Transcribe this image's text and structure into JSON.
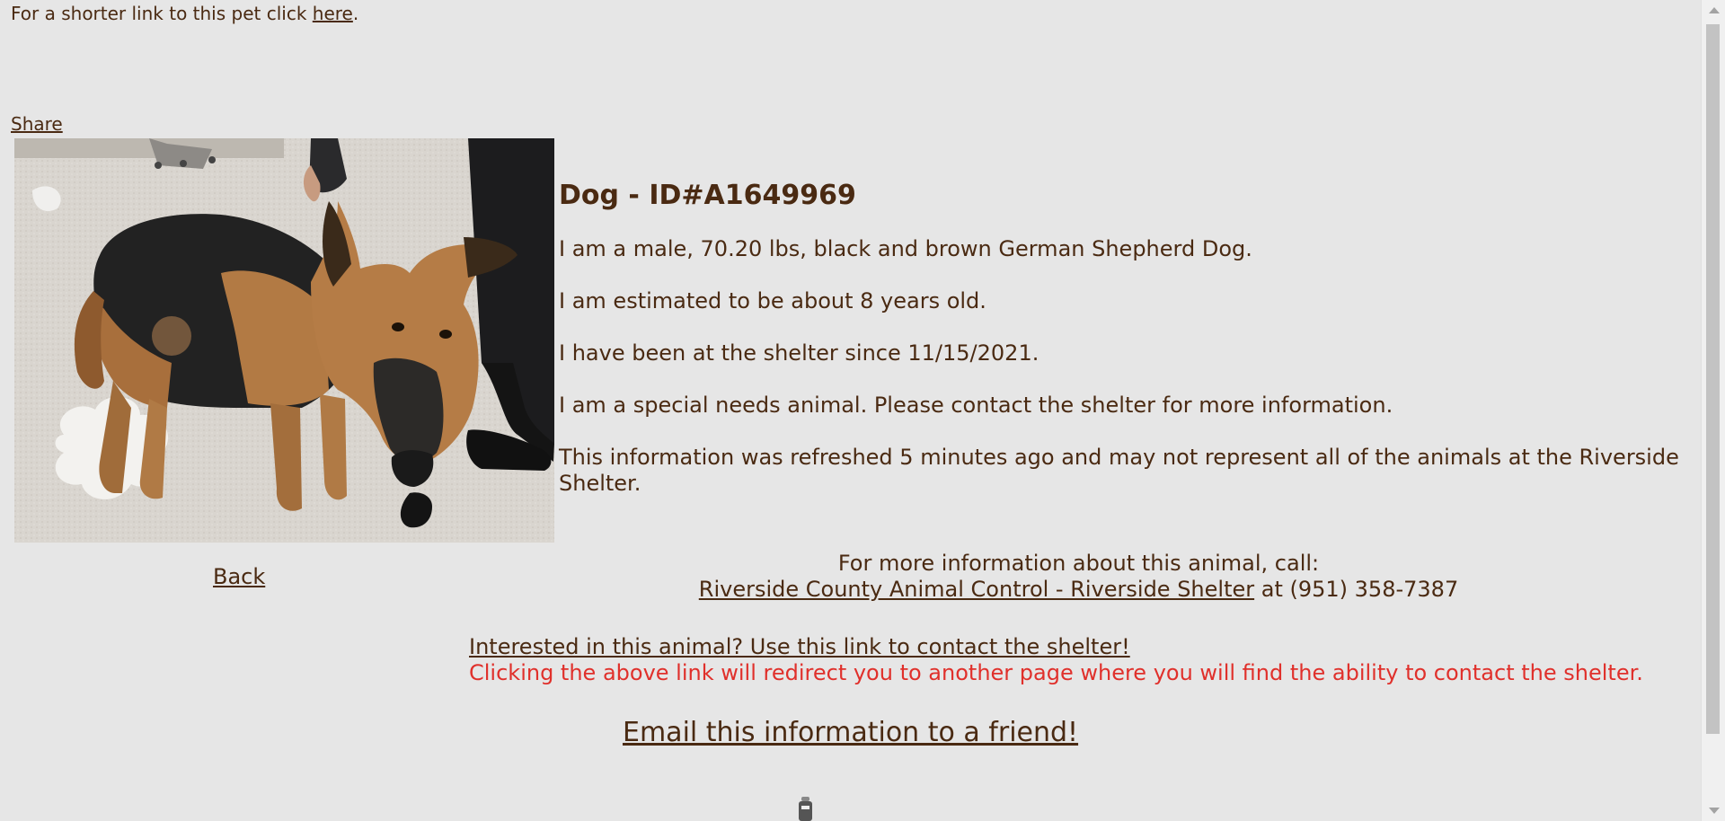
{
  "top_line": {
    "prefix": "For a shorter link to this pet click ",
    "link": "here",
    "suffix": "."
  },
  "share_label": "Share",
  "back_label": "Back",
  "animal": {
    "heading": "Dog - ID#A1649969",
    "description": "I am a male, 70.20 lbs, black and brown German Shepherd Dog.",
    "age": "I am estimated to be about 8 years old.",
    "since": "I have been at the shelter since 11/15/2021.",
    "special": "I am a special needs animal. Please contact the shelter for more information.",
    "refresh": "This information was refreshed 5 minutes ago and may not represent all of the animals at the Riverside Shelter."
  },
  "contact": {
    "intro": "For more information about this animal, call:",
    "shelter_link": "Riverside County Animal Control - Riverside Shelter",
    "phone_text": " at (951) 358-7387"
  },
  "interest": {
    "link": "Interested in this animal? Use this link to contact the shelter!",
    "note": "Clicking the above link will redirect you to another page where you will find the ability to contact the shelter."
  },
  "email_label": "Email this information to a friend!",
  "colors": {
    "background": "#e6e6e6",
    "text": "#4a2a12",
    "warning": "#e0302b"
  }
}
